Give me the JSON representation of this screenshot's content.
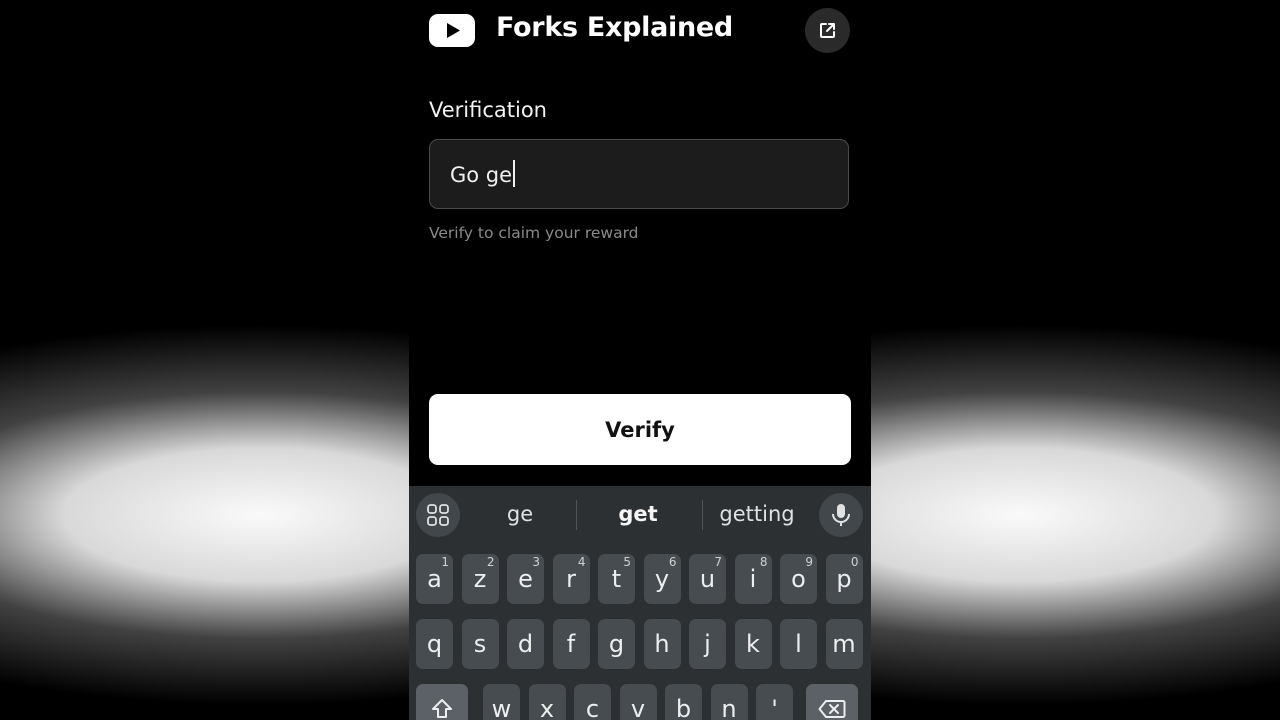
{
  "header": {
    "title": "Forks Explained",
    "logo_icon": "youtube-logo-icon",
    "external_icon": "open-external-icon"
  },
  "form": {
    "label": "Verification",
    "input_value": "Go ge",
    "helper": "Verify to claim your reward",
    "button_label": "Verify"
  },
  "keyboard": {
    "suggestions": [
      "ge",
      "get",
      "getting"
    ],
    "row1": [
      {
        "k": "a",
        "h": "1"
      },
      {
        "k": "z",
        "h": "2"
      },
      {
        "k": "e",
        "h": "3"
      },
      {
        "k": "r",
        "h": "4"
      },
      {
        "k": "t",
        "h": "5"
      },
      {
        "k": "y",
        "h": "6"
      },
      {
        "k": "u",
        "h": "7"
      },
      {
        "k": "i",
        "h": "8"
      },
      {
        "k": "o",
        "h": "9"
      },
      {
        "k": "p",
        "h": "0"
      }
    ],
    "row2": [
      "q",
      "s",
      "d",
      "f",
      "g",
      "h",
      "j",
      "k",
      "l",
      "m"
    ],
    "row3": [
      "w",
      "x",
      "c",
      "v",
      "b",
      "n",
      "'"
    ]
  },
  "colors": {
    "background": "#000000",
    "keyboard": "#2c3033",
    "key": "#474c50",
    "button": "#ffffff"
  }
}
